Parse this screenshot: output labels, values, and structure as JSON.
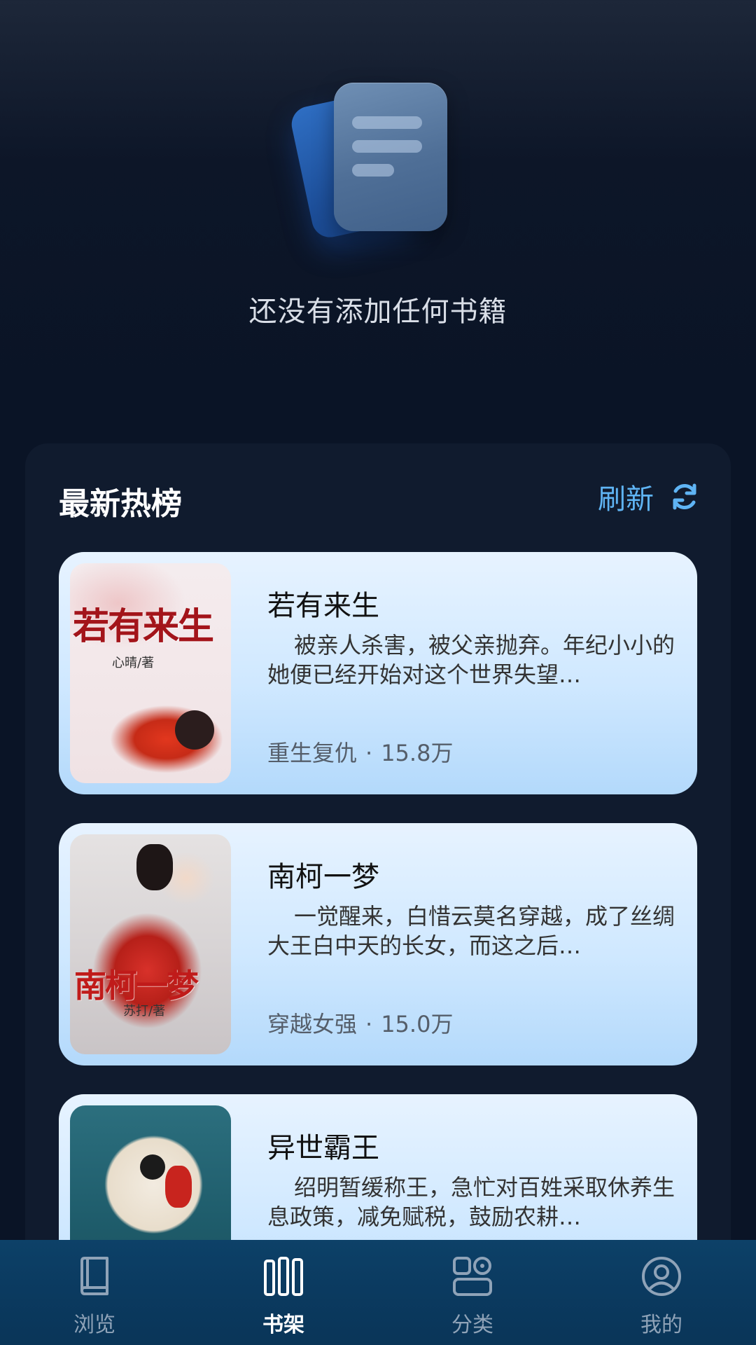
{
  "empty_state": {
    "message": "还没有添加任何书籍",
    "illustration_icon": "document-stack-icon"
  },
  "hot_list": {
    "title": "最新热榜",
    "refresh_label": "刷新",
    "refresh_icon": "refresh-icon",
    "books": [
      {
        "title": "若有来生",
        "description": "被亲人杀害，被父亲抛弃。年纪小小的她便已经开始对这个世界失望…",
        "genre": "重生复仇",
        "separator": "·",
        "count": "15.8万",
        "cover_title": "若有来生",
        "cover_author": "心晴/著"
      },
      {
        "title": "南柯一梦",
        "description": "一觉醒来，白惜云莫名穿越，成了丝绸大王白中天的长女，而这之后…",
        "genre": "穿越女强",
        "separator": "·",
        "count": "15.0万",
        "cover_title": "南柯一梦",
        "cover_author": "苏打/著"
      },
      {
        "title": "异世霸王",
        "description": "绍明暂缓称王，急忙对百姓采取休养生息政策，减免赋税，鼓励农耕…",
        "genre": "",
        "separator": "",
        "count": ""
      }
    ]
  },
  "tab_bar": {
    "tabs": [
      {
        "label": "浏览",
        "icon": "book-icon",
        "active": false
      },
      {
        "label": "书架",
        "icon": "bookshelf-icon",
        "active": true
      },
      {
        "label": "分类",
        "icon": "category-icon",
        "active": false
      },
      {
        "label": "我的",
        "icon": "user-icon",
        "active": false
      }
    ]
  },
  "colors": {
    "background": "#0a1426",
    "panel": "#101b2e",
    "accent": "#5fb4f4",
    "card_top": "#e7f3ff",
    "card_bottom": "#b3d9fb",
    "tab_bar": "#0b3b61"
  }
}
